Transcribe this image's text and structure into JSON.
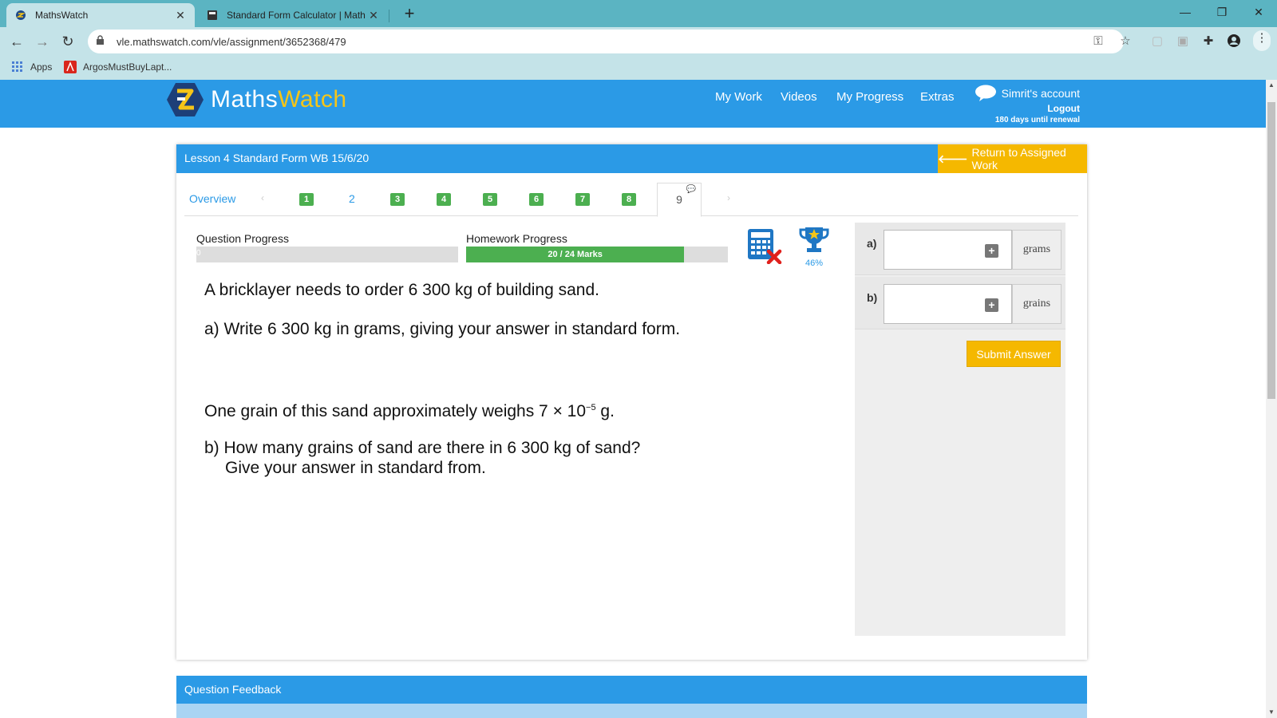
{
  "browser": {
    "tabs": [
      {
        "title": "MathsWatch",
        "active": true
      },
      {
        "title": "Standard Form Calculator | Math",
        "active": false
      }
    ],
    "url": "vle.mathswatch.com/vle/assignment/3652368/479",
    "bookmarks": [
      {
        "label": "Apps",
        "icon": "apps-grid-icon"
      },
      {
        "label": "ArgosMustBuyLapt...",
        "icon": "adobe-icon"
      }
    ]
  },
  "site": {
    "logo": {
      "part1": "Maths",
      "part2": "Watch"
    },
    "nav": [
      "My Work",
      "Videos",
      "My Progress",
      "Extras"
    ],
    "account": {
      "name": "Simrit's account",
      "logout": "Logout",
      "renewal": "180 days until renewal"
    }
  },
  "lesson": {
    "title": "Lesson 4 Standard Form WB 15/6/20",
    "return_label": "Return to Assigned Work",
    "overview_label": "Overview",
    "questions": [
      "1",
      "2",
      "3",
      "4",
      "5",
      "6",
      "7",
      "8",
      "9"
    ],
    "current_question": "9"
  },
  "progress": {
    "question_label": "Question Progress",
    "question_value_text": "0",
    "question_fraction": 0,
    "homework_label": "Homework Progress",
    "homework_text": "20 / 24 Marks",
    "homework_fraction": 0.833,
    "trophy_percent": "46%"
  },
  "question": {
    "line1": "A bricklayer needs to order 6 300 kg of building sand.",
    "line2": "a) Write 6 300 kg in grams, giving your answer in standard form.",
    "line3_pre": "One grain of this sand approximately weighs 7 × 10",
    "line3_exp": "−5",
    "line3_post": " g.",
    "line4": "b) How many grains of sand are there in 6 300 kg of sand?",
    "line5": "Give your answer in standard from."
  },
  "answers": [
    {
      "label": "a)",
      "unit": "grams",
      "value": ""
    },
    {
      "label": "b)",
      "unit": "grains",
      "value": ""
    }
  ],
  "submit_label": "Submit Answer",
  "feedback_title": "Question Feedback",
  "colors": {
    "brand_blue": "#2b9ae6",
    "accent_yellow": "#f5b800",
    "progress_green": "#4caf50",
    "browser_teal": "#5bb4c2"
  }
}
